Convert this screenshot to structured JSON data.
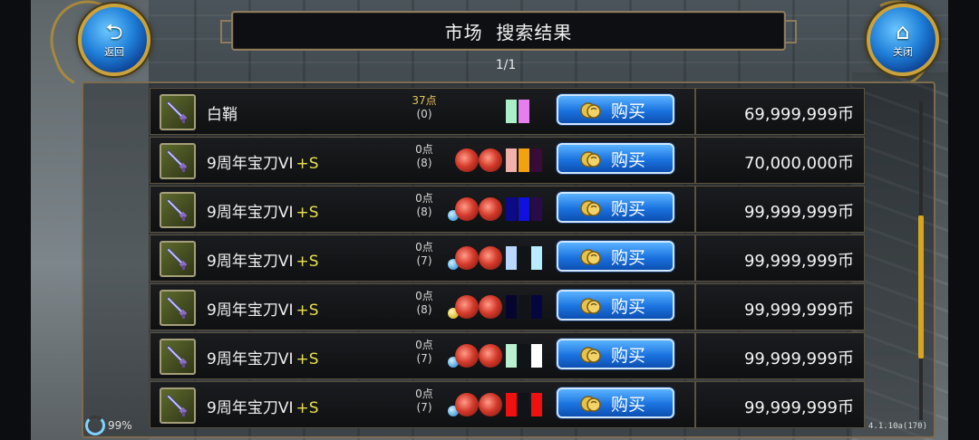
{
  "header": {
    "title": "市场  搜索结果",
    "page_counter": "1/1",
    "back_label": "返回",
    "close_label": "关闭"
  },
  "rows": [
    {
      "name": "白鞘",
      "plus": "",
      "points": "37点",
      "points_sub": "(0)",
      "gems": 0,
      "orb": "",
      "swatches": [
        "#a8f0c8",
        "#e77ef0"
      ],
      "buy_label": "购买",
      "price": "69,999,999币"
    },
    {
      "name": "9周年宝刀VI",
      "plus": "+S",
      "points": "0点",
      "points_sub": "(8)",
      "gems": 2,
      "orb": "",
      "swatches": [
        "#f2b1a8",
        "#f2a20e",
        "#3a0a3a"
      ],
      "buy_label": "购买",
      "price": "70,000,000币"
    },
    {
      "name": "9周年宝刀VI",
      "plus": "+S",
      "points": "0点",
      "points_sub": "(8)",
      "gems": 2,
      "orb": "blue",
      "swatches": [
        "#0a0a8a",
        "#1010e0",
        "#2a0a4a"
      ],
      "buy_label": "购买",
      "price": "99,999,999币"
    },
    {
      "name": "9周年宝刀VI",
      "plus": "+S",
      "points": "0点",
      "points_sub": "(7)",
      "gems": 2,
      "orb": "blue",
      "swatches": [
        "#b8d8ff",
        "#101418",
        "#b8ecff"
      ],
      "buy_label": "购买",
      "price": "99,999,999币"
    },
    {
      "name": "9周年宝刀VI",
      "plus": "+S",
      "points": "0点",
      "points_sub": "(8)",
      "gems": 2,
      "orb": "gold",
      "swatches": [
        "#050530",
        "#101418",
        "#050540"
      ],
      "buy_label": "购买",
      "price": "99,999,999币"
    },
    {
      "name": "9周年宝刀VI",
      "plus": "+S",
      "points": "0点",
      "points_sub": "(7)",
      "gems": 2,
      "orb": "blue",
      "swatches": [
        "#b8f0d0",
        "#101418",
        "#ffffff"
      ],
      "buy_label": "购买",
      "price": "99,999,999币"
    },
    {
      "name": "9周年宝刀VI",
      "plus": "+S",
      "points": "0点",
      "points_sub": "(7)",
      "gems": 2,
      "orb": "blue",
      "swatches": [
        "#f01010",
        "#101418",
        "#f01010"
      ],
      "buy_label": "购买",
      "price": "99,999,999币"
    }
  ],
  "status": {
    "battery": "99%",
    "version": "4.1.10a(170)"
  },
  "icons": {
    "back": "back-arrow-icon",
    "close": "home-icon",
    "item": "sword-icon",
    "buy": "coin-bag-icon"
  },
  "colors": {
    "accent_gold": "#c9a23d",
    "button_blue": "#1a72e0",
    "scrollbar": "#d9a520"
  }
}
